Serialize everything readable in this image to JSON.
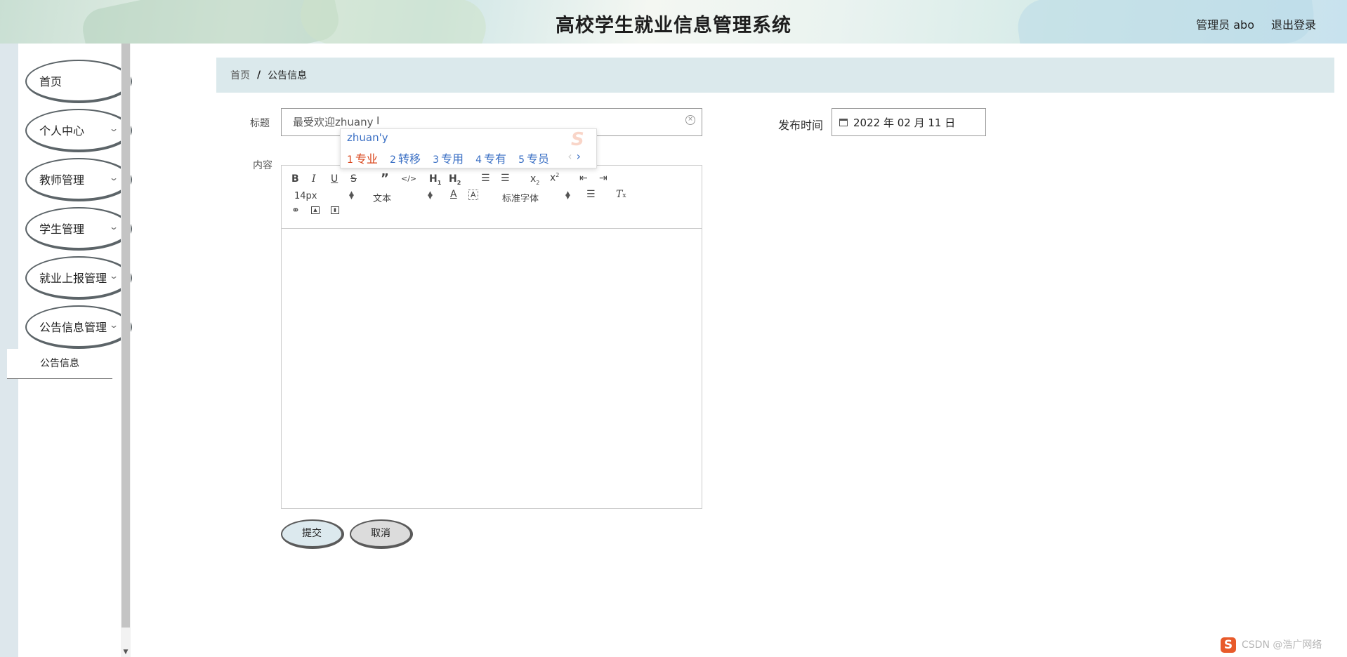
{
  "header": {
    "title": "高校学生就业信息管理系统",
    "user_text": "管理员 abo",
    "logout": "退出登录"
  },
  "sidebar": {
    "items": [
      {
        "label": "首页",
        "has_submenu": false
      },
      {
        "label": "个人中心",
        "has_submenu": true
      },
      {
        "label": "教师管理",
        "has_submenu": true
      },
      {
        "label": "学生管理",
        "has_submenu": true
      },
      {
        "label": "就业上报管理",
        "has_submenu": true
      },
      {
        "label": "公告信息管理",
        "has_submenu": true
      }
    ],
    "submenu": {
      "label": "公告信息"
    },
    "chevron": "⌄"
  },
  "breadcrumb": {
    "home": "首页",
    "separator": "/",
    "current": "公告信息"
  },
  "form": {
    "title_label": "标题",
    "title_value": "最受欢迎zhuany",
    "content_label": "内容",
    "date_label": "发布时间",
    "date_value": "2022 年 02 月 11 日",
    "submit": "提交",
    "cancel": "取消"
  },
  "ime": {
    "pinyin": "zhuan'y",
    "candidates": [
      {
        "num": "1",
        "text": "专业"
      },
      {
        "num": "2",
        "text": "转移"
      },
      {
        "num": "3",
        "text": "专用"
      },
      {
        "num": "4",
        "text": "专有"
      },
      {
        "num": "5",
        "text": "专员"
      }
    ],
    "prev": "‹",
    "next": "›"
  },
  "editor": {
    "font_size": "14px",
    "block_type": "文本",
    "font_family": "标准字体"
  },
  "watermark": "CSDN @浩广网络",
  "colors": {
    "breadcrumb_bg": "#dbe9ec",
    "submit_bg": "#dce9ee",
    "cancel_bg": "#dcdcdc",
    "ime_highlight": "#d9441a",
    "ime_candidate": "#3a6fc4"
  }
}
